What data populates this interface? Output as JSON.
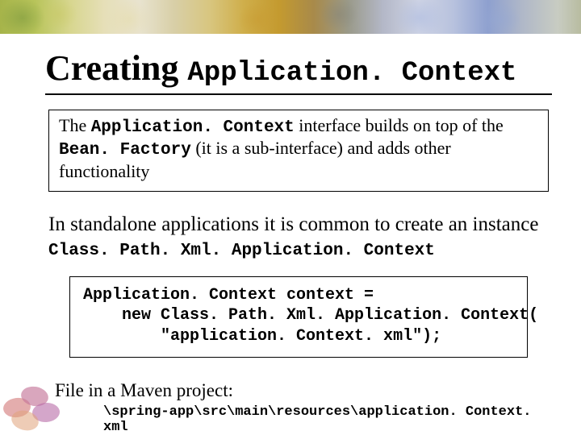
{
  "title": {
    "prefix": "Creating ",
    "mono": "Application. Context"
  },
  "box": {
    "t1": "The ",
    "m1": "Application. Context",
    "t2": " interface builds on top of the ",
    "m2": "Bean. Factory",
    "t3": " (it is a sub-interface) and adds other functionality"
  },
  "para": {
    "t1": "In standalone applications it is common to create an instance ",
    "m1": "Class. Path. Xml. Application. Context"
  },
  "code": "Application. Context context =\n    new Class. Path. Xml. Application. Context(\n        \"application. Context. xml\");",
  "footer": {
    "label": "File in a Maven project:",
    "path": "\\spring-app\\src\\main\\resources\\application. Context. xml"
  }
}
